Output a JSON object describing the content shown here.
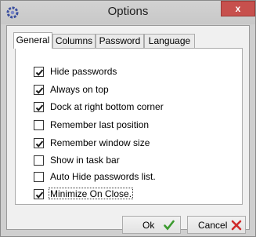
{
  "window": {
    "title": "Options",
    "close_glyph": "x"
  },
  "tabs": [
    {
      "label": "General",
      "active": true
    },
    {
      "label": "Columns",
      "active": false
    },
    {
      "label": "Password",
      "active": false
    },
    {
      "label": "Language",
      "active": false
    }
  ],
  "options": [
    {
      "label": "Hide passwords",
      "checked": true
    },
    {
      "label": "Always on top",
      "checked": true
    },
    {
      "label": "Dock at right bottom corner",
      "checked": true
    },
    {
      "label": "Remember last position",
      "checked": false
    },
    {
      "label": "Remember window size",
      "checked": true
    },
    {
      "label": "Show in task bar",
      "checked": false
    },
    {
      "label": "Auto Hide passwords list.",
      "checked": false
    },
    {
      "label": "Minimize On Close.",
      "checked": true
    }
  ],
  "buttons": {
    "ok_label": "Ok",
    "cancel_label": "Cancel"
  },
  "icons": {
    "app": "options-app-icon",
    "ok": "green-checkmark-icon",
    "cancel": "red-x-icon",
    "checkbox_mark": "checkmark-icon"
  },
  "colors": {
    "ok_icon": "#3a9a2e",
    "cancel_icon": "#d02a2a",
    "close_button": "#c7504d"
  }
}
